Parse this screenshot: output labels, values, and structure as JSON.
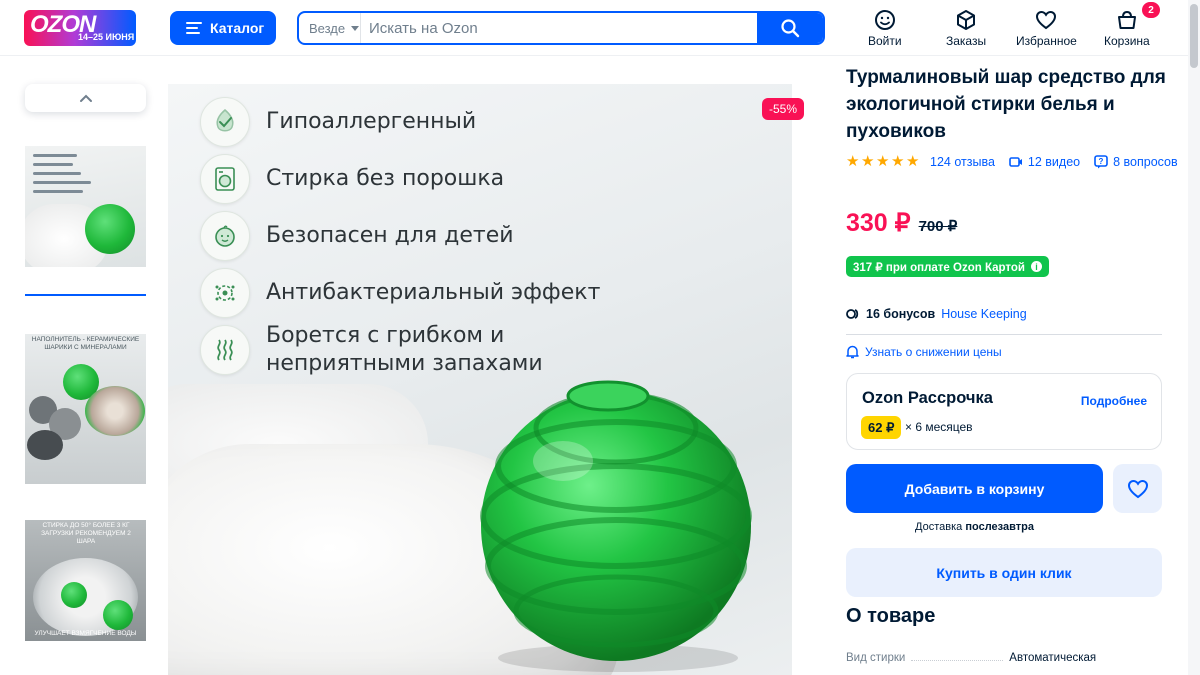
{
  "header": {
    "logo_text": "OZON",
    "logo_sub": "14–25 ИЮНЯ",
    "catalog_label": "Каталог",
    "search_scope": "Везде",
    "search_placeholder": "Искать на Ozon",
    "nav": [
      {
        "label": "Войти",
        "icon": "user-icon"
      },
      {
        "label": "Заказы",
        "icon": "box-icon"
      },
      {
        "label": "Избранное",
        "icon": "heart-icon"
      },
      {
        "label": "Корзина",
        "icon": "cart-icon",
        "badge": "2"
      }
    ]
  },
  "gallery": {
    "discount_badge": "-55%",
    "features": [
      "Гипоаллергенный",
      "Стирка без порошка",
      "Безопасен для детей",
      "Антибактериальный эффект",
      "Борется с грибком и неприятными запахами"
    ],
    "thumb_captions": {
      "thumb2": "НАПОЛНИТЕЛЬ - КЕРАМИЧЕСКИЕ ШАРИКИ С МИНЕРАЛАМИ",
      "thumb3_top": "СТИРКА ДО 50° БОЛЕЕ 3 КГ ЗАГРУЗКИ РЕКОМЕНДУЕМ 2 ШАРА",
      "thumb3_bottom": "УЛУЧШАЕТ ВЗМЯГЧЕНИЕ ВОДЫ"
    }
  },
  "product": {
    "title": "Турмалиновый шар средство для экологичной стирки белья и пуховиков",
    "rating_stars": 5,
    "reviews": "124 отзыва",
    "videos": "12 видео",
    "questions": "8 вопросов",
    "price": "330 ₽",
    "old_price": "700 ₽",
    "card_price": "317 ₽ при оплате Ozon Картой",
    "bonus_amount": "16 бонусов",
    "seller": "House Keeping",
    "notify": "Узнать о снижении цены",
    "installment": {
      "title": "Ozon Рассрочка",
      "more": "Подробнее",
      "amount": "62 ₽",
      "term": "× 6 месяцев"
    },
    "add_to_cart": "Добавить в корзину",
    "delivery_prefix": "Доставка",
    "delivery_when": "послезавтра",
    "one_click": "Купить в один клик",
    "about_title": "О товаре",
    "specs": [
      {
        "key": "Вид стирки",
        "value": "Автоматическая"
      }
    ]
  },
  "colors": {
    "brand_blue": "#005bff",
    "price_red": "#f91155",
    "card_green": "#10c44c",
    "star": "#ffa800",
    "installment_yellow": "#ffd500"
  }
}
